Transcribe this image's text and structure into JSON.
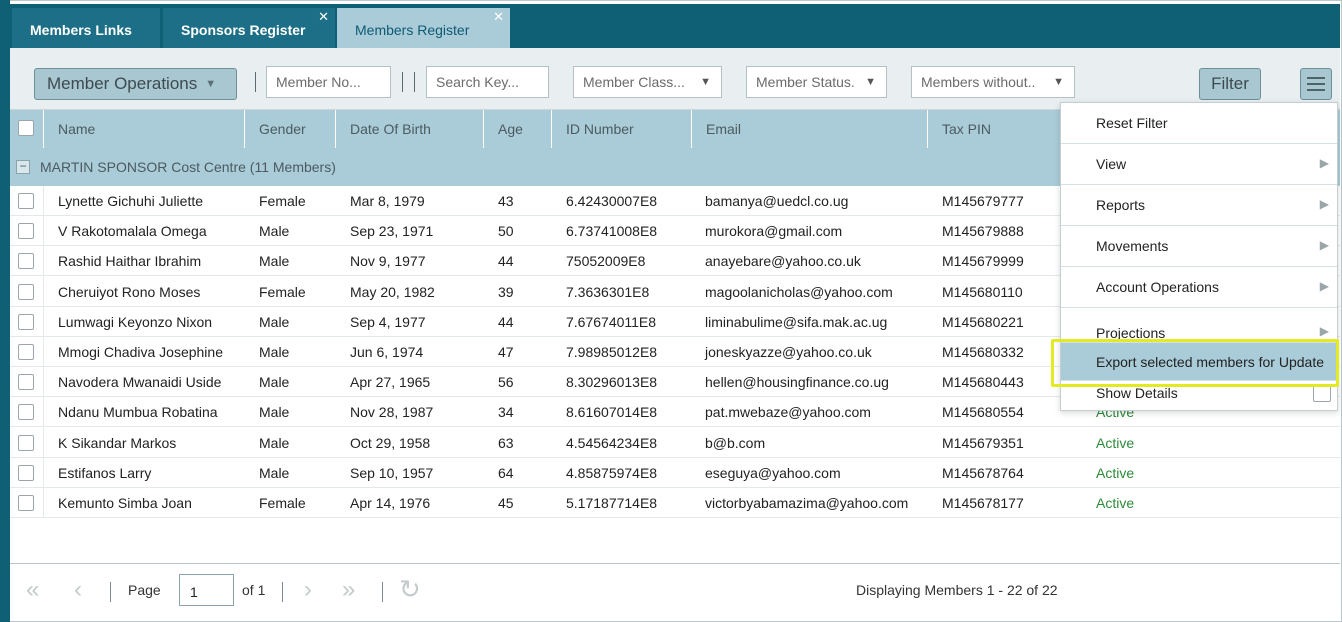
{
  "tabs": [
    {
      "label": "Members Links",
      "active": false,
      "closable": false
    },
    {
      "label": "Sponsors Register",
      "active": false,
      "closable": true
    },
    {
      "label": "Members Register",
      "active": true,
      "closable": true
    }
  ],
  "toolbar": {
    "operations_label": "Member Operations",
    "member_no_placeholder": "Member No...",
    "search_key_placeholder": "Search Key...",
    "member_class": "Member Class...",
    "member_status": "Member Status.",
    "members_without": "Members without..",
    "filter_label": "Filter"
  },
  "columns": [
    "Name",
    "Gender",
    "Date Of Birth",
    "Age",
    "ID Number",
    "Email",
    "Tax PIN"
  ],
  "group_label": "MARTIN SPONSOR Cost Centre (11 Members)",
  "rows": [
    {
      "name": "Lynette Gichuhi Juliette",
      "gender": "Female",
      "dob": "Mar 8, 1979",
      "age": "43",
      "id": "6.42430007E8",
      "email": "bamanya@uedcl.co.ug",
      "pin": "M145679777",
      "status": ""
    },
    {
      "name": "V Rakotomalala Omega",
      "gender": "Male",
      "dob": "Sep 23, 1971",
      "age": "50",
      "id": "6.73741008E8",
      "email": "murokora@gmail.com",
      "pin": "M145679888",
      "status": ""
    },
    {
      "name": "Rashid Haithar Ibrahim",
      "gender": "Male",
      "dob": "Nov 9, 1977",
      "age": "44",
      "id": "75052009E8",
      "email": "anayebare@yahoo.co.uk",
      "pin": "M145679999",
      "status": ""
    },
    {
      "name": "Cheruiyot Rono Moses",
      "gender": "Female",
      "dob": "May 20, 1982",
      "age": "39",
      "id": "7.3636301E8",
      "email": "magoolanicholas@yahoo.com",
      "pin": "M145680110",
      "status": ""
    },
    {
      "name": "Lumwagi Keyonzo Nixon",
      "gender": "Male",
      "dob": "Sep 4, 1977",
      "age": "44",
      "id": "7.67674011E8",
      "email": "liminabulime@sifa.mak.ac.ug",
      "pin": "M145680221",
      "status": ""
    },
    {
      "name": "Mmogi Chadiva Josephine",
      "gender": "Male",
      "dob": "Jun 6, 1974",
      "age": "47",
      "id": "7.98985012E8",
      "email": "joneskyazze@yahoo.co.uk",
      "pin": "M145680332",
      "status": ""
    },
    {
      "name": "Navodera Mwanaidi Uside",
      "gender": "Male",
      "dob": "Apr 27, 1965",
      "age": "56",
      "id": "8.30296013E8",
      "email": "hellen@housingfinance.co.ug",
      "pin": "M145680443",
      "status": ""
    },
    {
      "name": "Ndanu Mumbua Robatina",
      "gender": "Male",
      "dob": "Nov 28, 1987",
      "age": "34",
      "id": "8.61607014E8",
      "email": "pat.mwebaze@yahoo.com",
      "pin": "M145680554",
      "status": "Active"
    },
    {
      "name": "K Sikandar Markos",
      "gender": "Male",
      "dob": "Oct 29, 1958",
      "age": "63",
      "id": "4.54564234E8",
      "email": "b@b.com",
      "pin": "M145679351",
      "status": "Active"
    },
    {
      "name": "Estifanos Larry",
      "gender": "Male",
      "dob": "Sep 10, 1957",
      "age": "64",
      "id": "4.85875974E8",
      "email": "eseguya@yahoo.com",
      "pin": "M145678764",
      "status": "Active"
    },
    {
      "name": "Kemunto Simba Joan",
      "gender": "Female",
      "dob": "Apr 14, 1976",
      "age": "45",
      "id": "5.17187714E8",
      "email": "victorbyabamazima@yahoo.com",
      "pin": "M145678177",
      "status": "Active"
    }
  ],
  "menu": [
    {
      "label": "Reset Filter",
      "submenu": false,
      "highlighted": false,
      "checkbox": false
    },
    {
      "label": "View",
      "submenu": true,
      "highlighted": false,
      "checkbox": false
    },
    {
      "label": "Reports",
      "submenu": true,
      "highlighted": false,
      "checkbox": false
    },
    {
      "label": "Movements",
      "submenu": true,
      "highlighted": false,
      "checkbox": false
    },
    {
      "label": "Account Operations",
      "submenu": true,
      "highlighted": false,
      "checkbox": false
    },
    {
      "label": "Projections",
      "submenu": true,
      "highlighted": false,
      "checkbox": false
    },
    {
      "label": "Export selected members for Update",
      "submenu": false,
      "highlighted": true,
      "checkbox": false
    },
    {
      "label": "Show Details",
      "submenu": false,
      "highlighted": false,
      "checkbox": true
    }
  ],
  "pager": {
    "page_label": "Page",
    "page_value": "1",
    "of_label": "of 1",
    "display_text": "Displaying Members 1 - 22 of 22"
  },
  "colors": {
    "tabbar": "#0f6075",
    "header": "#a9ccd8",
    "status_active": "#2e8b3a",
    "highlight_frame": "#e2ea24"
  },
  "icons": {
    "first_page": "double-chevron-left-icon",
    "prev_page": "chevron-left-icon",
    "next_page": "chevron-right-icon",
    "last_page": "double-chevron-right-icon",
    "refresh": "refresh-icon",
    "menu": "hamburger-icon"
  }
}
